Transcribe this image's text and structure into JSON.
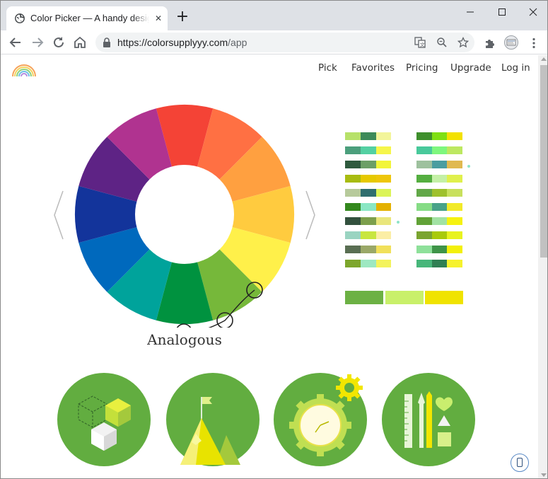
{
  "browser": {
    "tab_title": "Color Picker — A handy design tool",
    "url_host": "https://colorsupplyyy.com",
    "url_path": "/app"
  },
  "nav": {
    "items": [
      "Pick",
      "Favorites",
      "Pricing",
      "Upgrade",
      "Log in"
    ]
  },
  "picker": {
    "scheme_name": "Analogous",
    "wheel_colors": [
      "#f44336",
      "#ff7043",
      "#ffa040",
      "#ffcb3f",
      "#fff04a",
      "#76b83a",
      "#00923f",
      "#00a39b",
      "#0069bd",
      "#13349b",
      "#5e2385",
      "#b03390"
    ],
    "selected_colors": [
      "#6cb144",
      "#c9f06a",
      "#f0e300"
    ]
  },
  "swatch_combos": {
    "left": [
      [
        "#b7e169",
        "#3d8a59",
        "#f3f59a"
      ],
      [
        "#4b9f7c",
        "#53d0a2",
        "#f6f64a"
      ],
      [
        "#2f5a3e",
        "#6d9f67",
        "#f2f53a"
      ],
      [
        "#a8bc10",
        "#e6c900",
        "#eec60a"
      ],
      [
        "#b7ca9b",
        "#2f6e6e",
        "#dbf457"
      ],
      [
        "#33881d",
        "#8ae7c4",
        "#e4b100"
      ],
      [
        "#33513e",
        "#7c9f4c",
        "#e9e67c"
      ],
      [
        "#9ad4c1",
        "#c8e640",
        "#fbeea5"
      ],
      [
        "#596e52",
        "#9aa868",
        "#f1e05a"
      ],
      [
        "#7da62c",
        "#9de8c1",
        "#f3f35c"
      ]
    ],
    "right": [
      [
        "#3e8f2c",
        "#7fdf12",
        "#f3e100"
      ],
      [
        "#48c99b",
        "#7ef77e",
        "#bde861"
      ],
      [
        "#9ec19e",
        "#4b9da0",
        "#e0b950"
      ],
      [
        "#54ae40",
        "#c4f0a6",
        "#e0f04c"
      ],
      [
        "#62a848",
        "#9ec12c",
        "#c8e05d"
      ],
      [
        "#86dc86",
        "#48a288",
        "#f2ea29"
      ],
      [
        "#61a237",
        "#a2e2a3",
        "#f6f210"
      ],
      [
        "#7aa430",
        "#a9ca0a",
        "#e8f31f"
      ],
      [
        "#8ee09a",
        "#3e9448",
        "#f3f00a"
      ],
      [
        "#47b67a",
        "#2f7f53",
        "#f6f22d"
      ]
    ]
  },
  "features": {
    "circle_color": "#62ad40",
    "icons": [
      "cubes-icon",
      "mountain-flag-icon",
      "clock-gear-icon",
      "design-tools-icon"
    ]
  }
}
